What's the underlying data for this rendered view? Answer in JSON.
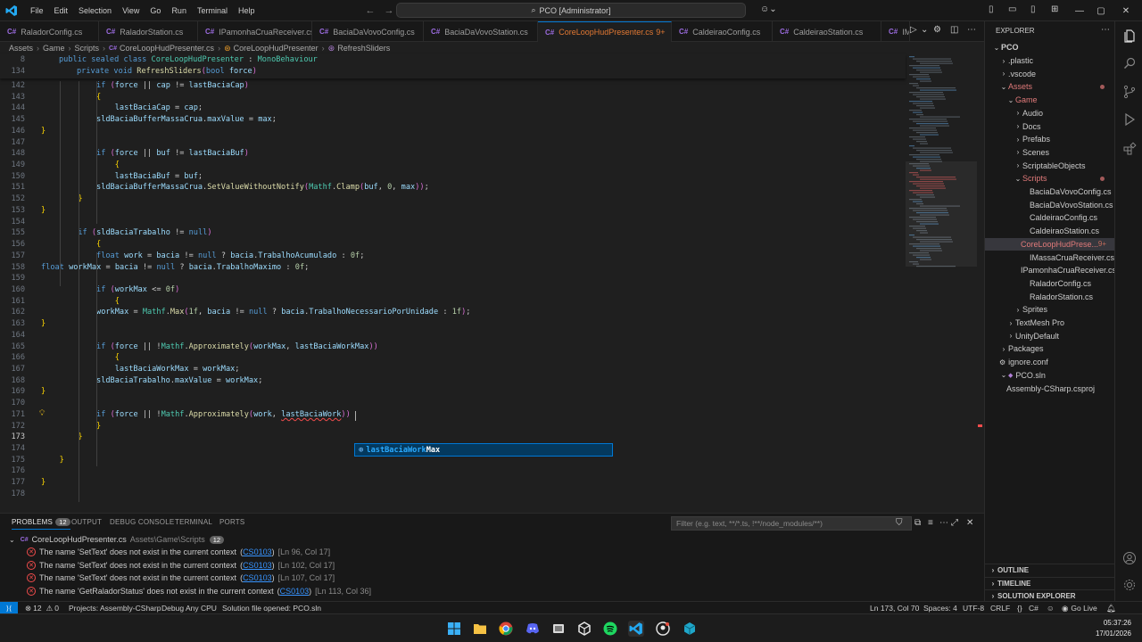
{
  "titlebar": {
    "menu": [
      "File",
      "Edit",
      "Selection",
      "View",
      "Go",
      "Run",
      "Terminal",
      "Help"
    ],
    "search_text": "PCO [Administrator]"
  },
  "tabs": [
    {
      "label": "RaladorConfig.cs"
    },
    {
      "label": "RaladorStation.cs"
    },
    {
      "label": "IPamonhaCruaReceiver.cs"
    },
    {
      "label": "BaciaDaVovoConfig.cs"
    },
    {
      "label": "BaciaDaVovoStation.cs"
    },
    {
      "label": "CoreLoopHudPresenter.cs",
      "modified": "9+",
      "active": true
    },
    {
      "label": "CaldeiraoConfig.cs"
    },
    {
      "label": "CaldeiraoStation.cs"
    },
    {
      "label": "IMas"
    }
  ],
  "breadcrumb": [
    "Assets",
    "Game",
    "Scripts",
    "CoreLoopHudPresenter.cs",
    "CoreLoopHudPresenter",
    "RefreshSliders"
  ],
  "editor": {
    "sticky": [
      {
        "ln": "8",
        "text": "public sealed class CoreLoopHudPresenter : MonoBehaviour"
      },
      {
        "ln": "134",
        "text": "private void RefreshSliders(bool force)"
      }
    ],
    "lines": [
      {
        "ln": "142",
        "text": "if (force || cap != lastBaciaCap)"
      },
      {
        "ln": "143",
        "text": "{"
      },
      {
        "ln": "144",
        "text": "lastBaciaCap = cap;"
      },
      {
        "ln": "145",
        "text": "sldBaciaBufferMassaCrua.maxValue = max;"
      },
      {
        "ln": "146",
        "text": "}"
      },
      {
        "ln": "147",
        "text": ""
      },
      {
        "ln": "148",
        "text": "if (force || buf != lastBaciaBuf)"
      },
      {
        "ln": "149",
        "text": "{"
      },
      {
        "ln": "150",
        "text": "lastBaciaBuf = buf;"
      },
      {
        "ln": "151",
        "text": "sldBaciaBufferMassaCrua.SetValueWithoutNotify(Mathf.Clamp(buf, 0, max));"
      },
      {
        "ln": "152",
        "text": "}"
      },
      {
        "ln": "153",
        "text": "}"
      },
      {
        "ln": "154",
        "text": ""
      },
      {
        "ln": "155",
        "text": "if (sldBaciaTrabalho != null)"
      },
      {
        "ln": "156",
        "text": "{"
      },
      {
        "ln": "157",
        "text": "float work = bacia != null ? bacia.TrabalhoAcumulado : 0f;"
      },
      {
        "ln": "158",
        "text": "float workMax = bacia != null ? bacia.TrabalhoMaximo : 0f;"
      },
      {
        "ln": "159",
        "text": ""
      },
      {
        "ln": "160",
        "text": "if (workMax <= 0f)"
      },
      {
        "ln": "161",
        "text": "{"
      },
      {
        "ln": "162",
        "text": "workMax = Mathf.Max(1f, bacia != null ? bacia.TrabalhoNecessarioPorUnidade : 1f);"
      },
      {
        "ln": "163",
        "text": "}"
      },
      {
        "ln": "164",
        "text": ""
      },
      {
        "ln": "165",
        "text": "if (force || !Mathf.Approximately(workMax, lastBaciaWorkMax))"
      },
      {
        "ln": "166",
        "text": "{"
      },
      {
        "ln": "167",
        "text": "lastBaciaWorkMax = workMax;"
      },
      {
        "ln": "168",
        "text": "sldBaciaTrabalho.maxValue = workMax;"
      },
      {
        "ln": "169",
        "text": "}"
      },
      {
        "ln": "170",
        "text": ""
      },
      {
        "ln": "171",
        "text": "if (force || !Mathf.Approximately(work, lastBaciaWork))"
      },
      {
        "ln": "172",
        "text": "}"
      },
      {
        "ln": "173",
        "text": "}"
      },
      {
        "ln": "174",
        "text": ""
      },
      {
        "ln": "175",
        "text": "}"
      },
      {
        "ln": "176",
        "text": ""
      },
      {
        "ln": "177",
        "text": "}"
      },
      {
        "ln": "178",
        "text": ""
      }
    ],
    "suggestion": {
      "match": "lastBaciaWork",
      "rest": "Max"
    }
  },
  "explorer": {
    "title": "EXPLORER",
    "items": [
      {
        "label": "PCO",
        "depth": 0,
        "chev": "v",
        "bold": true
      },
      {
        "label": ".plastic",
        "depth": 1,
        "chev": ">"
      },
      {
        "label": ".vscode",
        "depth": 1,
        "chev": ">"
      },
      {
        "label": "Assets",
        "depth": 1,
        "chev": "v",
        "color": "#e07a7a",
        "dot": true
      },
      {
        "label": "Game",
        "depth": 2,
        "chev": "v",
        "color": "#e07a7a"
      },
      {
        "label": "Audio",
        "depth": 3,
        "chev": ">"
      },
      {
        "label": "Docs",
        "depth": 3,
        "chev": ">"
      },
      {
        "label": "Prefabs",
        "depth": 3,
        "chev": ">"
      },
      {
        "label": "Scenes",
        "depth": 3,
        "chev": ">"
      },
      {
        "label": "ScriptableObjects",
        "depth": 3,
        "chev": ">"
      },
      {
        "label": "Scripts",
        "depth": 3,
        "chev": "v",
        "color": "#e07a7a",
        "dot": true
      },
      {
        "label": "BaciaDaVovoConfig.cs",
        "depth": 4
      },
      {
        "label": "BaciaDaVovoStation.cs",
        "depth": 4
      },
      {
        "label": "CaldeiraoConfig.cs",
        "depth": 4
      },
      {
        "label": "CaldeiraoStation.cs",
        "depth": 4
      },
      {
        "label": "CoreLoopHudPrese...",
        "depth": 4,
        "sel": true,
        "color": "#e07a7a",
        "badge": "9+"
      },
      {
        "label": "IMassaCruaReceiver.cs",
        "depth": 4
      },
      {
        "label": "IPamonhaCruaReceiver.cs",
        "depth": 4
      },
      {
        "label": "RaladorConfig.cs",
        "depth": 4
      },
      {
        "label": "RaladorStation.cs",
        "depth": 4
      },
      {
        "label": "Sprites",
        "depth": 3,
        "chev": ">"
      },
      {
        "label": "TextMesh Pro",
        "depth": 2,
        "chev": ">"
      },
      {
        "label": "UnityDefault",
        "depth": 2,
        "chev": ">"
      },
      {
        "label": "Packages",
        "depth": 1,
        "chev": ">"
      },
      {
        "label": "ignore.conf",
        "depth": 1
      },
      {
        "label": "PCO.sln",
        "depth": 1,
        "chev": "v"
      },
      {
        "label": "Assembly-CSharp.csproj",
        "depth": 2
      }
    ],
    "sections": [
      "OUTLINE",
      "TIMELINE",
      "SOLUTION EXPLORER"
    ]
  },
  "panel": {
    "tabs": [
      "PROBLEMS",
      "OUTPUT",
      "DEBUG CONSOLE",
      "TERMINAL",
      "PORTS"
    ],
    "problem_count": "12",
    "filter_placeholder": "Filter (e.g. text, **/*.ts, !**/node_modules/**)",
    "file": {
      "name": "CoreLoopHudPresenter.cs",
      "path": "Assets\\Game\\Scripts",
      "count": "12"
    },
    "problems": [
      {
        "msg": "The name 'SetText' does not exist in the current context",
        "code": "CS0103",
        "loc": "[Ln 96, Col 17]"
      },
      {
        "msg": "The name 'SetText' does not exist in the current context",
        "code": "CS0103",
        "loc": "[Ln 102, Col 17]"
      },
      {
        "msg": "The name 'SetText' does not exist in the current context",
        "code": "CS0103",
        "loc": "[Ln 107, Col 17]"
      },
      {
        "msg": "The name 'GetRaladorStatus' does not exist in the current context",
        "code": "CS0103",
        "loc": "[Ln 113, Col 36]"
      }
    ]
  },
  "statusbar": {
    "errors": "12",
    "warnings": "0",
    "project": "Projects: Assembly-CSharp",
    "config": "Debug Any CPU",
    "solution": "Solution file opened: PCO.sln",
    "position": "Ln 173, Col 70",
    "spaces": "Spaces: 4",
    "encoding": "UTF-8",
    "eol": "CRLF",
    "lang": "C#",
    "live": "Go Live"
  },
  "taskbar": {
    "time": "05:37:26",
    "date": "17/01/2026"
  },
  "colors": {
    "accent": "#0078d4",
    "error": "#f14c4c",
    "modified": "#e37933"
  }
}
